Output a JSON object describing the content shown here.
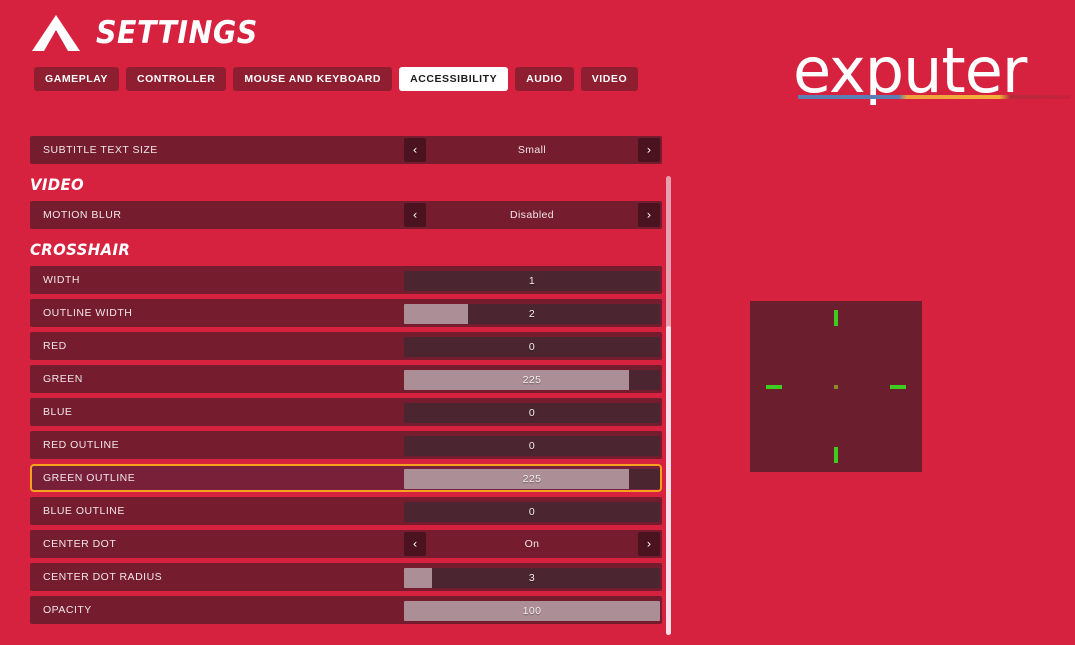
{
  "header": {
    "title": "SETTINGS",
    "brand_icon": "mountain-a-icon"
  },
  "tabs": [
    {
      "label": "GAMEPLAY",
      "active": false
    },
    {
      "label": "CONTROLLER",
      "active": false
    },
    {
      "label": "MOUSE AND KEYBOARD",
      "active": false
    },
    {
      "label": "ACCESSIBILITY",
      "active": true
    },
    {
      "label": "AUDIO",
      "active": false
    },
    {
      "label": "VIDEO",
      "active": false
    }
  ],
  "settings": [
    {
      "kind": "stepper",
      "label": "SUBTITLE TEXT SIZE",
      "value": "Small",
      "prev_icon": "chevron-left-icon",
      "next_icon": "chevron-right-icon",
      "highlighted": false
    },
    {
      "kind": "heading",
      "label": "VIDEO"
    },
    {
      "kind": "stepper",
      "label": "MOTION BLUR",
      "value": "Disabled",
      "prev_icon": "chevron-left-icon",
      "next_icon": "chevron-right-icon",
      "highlighted": false
    },
    {
      "kind": "heading",
      "label": "CROSSHAIR"
    },
    {
      "kind": "slider",
      "label": "WIDTH",
      "value": "1",
      "fill_percent": 0,
      "highlighted": false
    },
    {
      "kind": "slider",
      "label": "OUTLINE WIDTH",
      "value": "2",
      "fill_percent": 25,
      "highlighted": false
    },
    {
      "kind": "slider",
      "label": "RED",
      "value": "0",
      "fill_percent": 0,
      "highlighted": false
    },
    {
      "kind": "slider",
      "label": "GREEN",
      "value": "225",
      "fill_percent": 88,
      "highlighted": false
    },
    {
      "kind": "slider",
      "label": "BLUE",
      "value": "0",
      "fill_percent": 0,
      "highlighted": false
    },
    {
      "kind": "slider",
      "label": "RED OUTLINE",
      "value": "0",
      "fill_percent": 0,
      "highlighted": false
    },
    {
      "kind": "slider",
      "label": "GREEN OUTLINE",
      "value": "225",
      "fill_percent": 88,
      "highlighted": true
    },
    {
      "kind": "slider",
      "label": "BLUE OUTLINE",
      "value": "0",
      "fill_percent": 0,
      "highlighted": false
    },
    {
      "kind": "stepper",
      "label": "CENTER DOT",
      "value": "On",
      "prev_icon": "chevron-left-icon",
      "next_icon": "chevron-right-icon",
      "highlighted": false
    },
    {
      "kind": "slider",
      "label": "CENTER DOT RADIUS",
      "value": "3",
      "fill_percent": 11,
      "highlighted": false
    },
    {
      "kind": "slider",
      "label": "OPACITY",
      "value": "100",
      "fill_percent": 100,
      "highlighted": false
    }
  ],
  "scrollbar": {
    "name": "settings-scrollbar"
  },
  "site_logo": {
    "text": "exputer",
    "underline_colors": [
      "#5b7fb5",
      "#f3b23a",
      "#c9203c"
    ]
  },
  "crosshair_preview": {
    "name": "crosshair-preview",
    "background": "#6b1f2e",
    "mark_color": "#3ecc1e",
    "center_dot_color": "#8a8a28"
  },
  "colors": {
    "page_background": "#d6213f",
    "row_background": "#751d2f",
    "highlight_border": "#f5a21e",
    "slider_fill": "#ab8e96",
    "slider_track": "#4b2530"
  }
}
